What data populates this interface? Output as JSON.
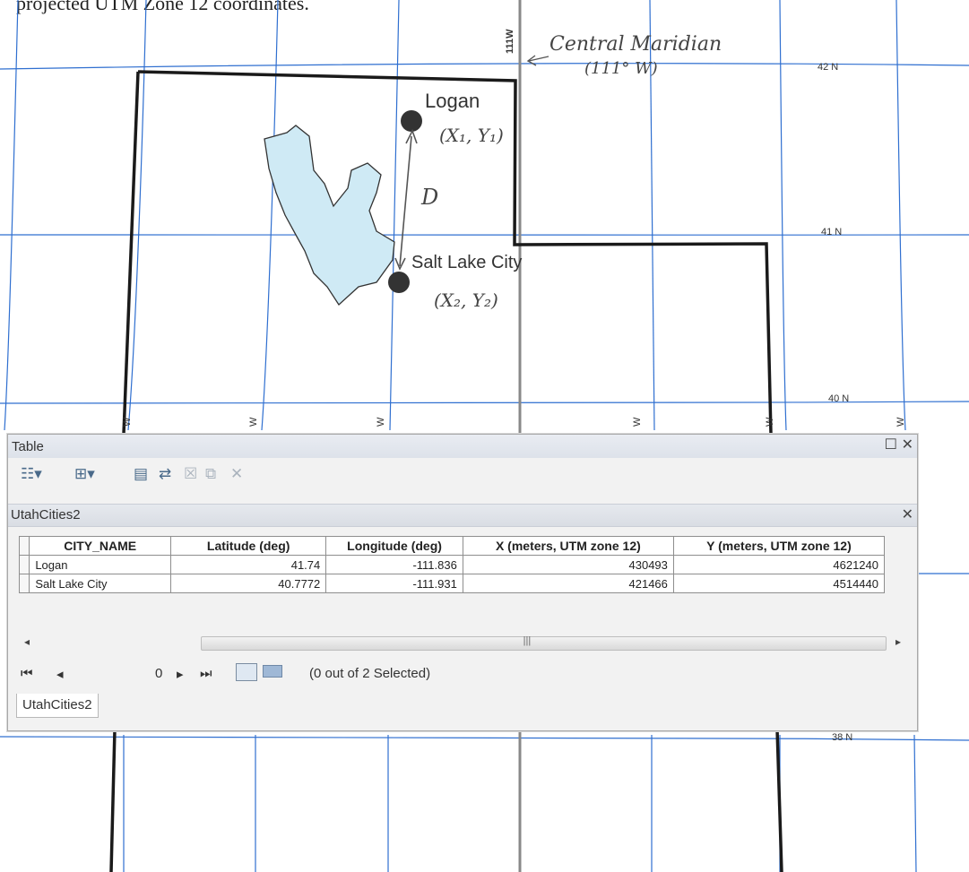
{
  "caption": "projected UTM Zone 12 coordinates.",
  "map": {
    "lat_labels": [
      "42 N",
      "41 N",
      "40 N",
      "38 N"
    ],
    "meridian_label": "111W",
    "west_tick_label": "W",
    "cities": [
      {
        "name": "Logan"
      },
      {
        "name": "Salt Lake City"
      }
    ],
    "annotations": {
      "central_meridian_line1": "Central Maridian",
      "central_meridian_line2": "(111° W)",
      "logan_coords": "(X₁, Y₁)",
      "slc_coords": "(X₂, Y₂)",
      "distance": "D"
    }
  },
  "table_window": {
    "title": "Table",
    "tab_name": "UtahCities2",
    "toolbar_icons": [
      "table-options-icon",
      "related-tables-icon",
      "select-by-attributes-icon",
      "switch-selection-icon",
      "clear-selection-icon",
      "zoom-to-selected-icon",
      "delete-selected-icon"
    ],
    "columns": [
      "CITY_NAME",
      "Latitude (deg)",
      "Longitude (deg)",
      "X (meters, UTM zone 12)",
      "Y (meters, UTM zone 12)"
    ],
    "rows": [
      {
        "city": "Logan",
        "lat": "41.74",
        "lon": "-111.836",
        "x": "430493",
        "y": "4621240"
      },
      {
        "city": "Salt Lake City",
        "lat": "40.7772",
        "lon": "-111.931",
        "x": "421466",
        "y": "4514440"
      }
    ],
    "nav": {
      "record": "0",
      "status": "(0 out of 2 Selected)"
    },
    "bottom_tab": "UtahCities2",
    "colors": {
      "lake": "#cfeaf5",
      "graticule": "#2f6fd0",
      "border": "#1a1a1a"
    }
  }
}
